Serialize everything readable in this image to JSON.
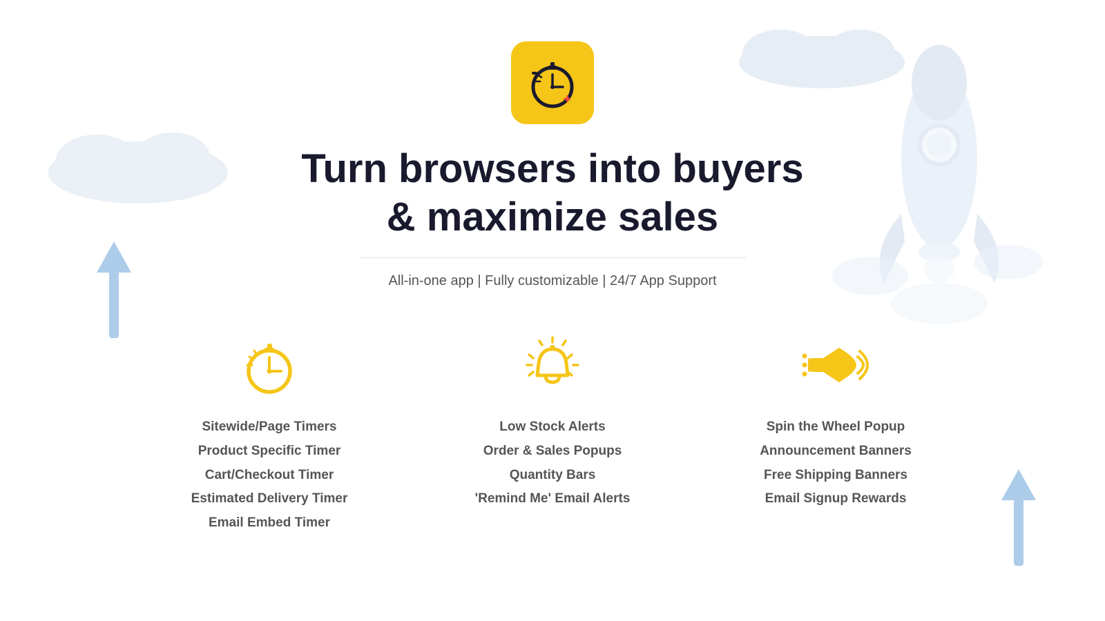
{
  "app": {
    "headline_line1": "Turn browsers into buyers",
    "headline_line2": "& maximize sales",
    "subtitle": "All-in-one app | Fully customizable | 24/7 App Support"
  },
  "features": [
    {
      "id": "timers",
      "icon": "stopwatch-icon",
      "items": [
        "Sitewide/Page Timers",
        "Product Specific Timer",
        "Cart/Checkout Timer",
        "Estimated Delivery Timer",
        "Email Embed Timer"
      ]
    },
    {
      "id": "alerts",
      "icon": "alert-icon",
      "items": [
        "Low Stock Alerts",
        "Order & Sales Popups",
        "Quantity Bars",
        "'Remind Me' Email Alerts"
      ]
    },
    {
      "id": "banners",
      "icon": "megaphone-icon",
      "items": [
        "Spin the Wheel Popup",
        "Announcement Banners",
        "Free Shipping Banners",
        "Email Signup Rewards"
      ]
    }
  ]
}
